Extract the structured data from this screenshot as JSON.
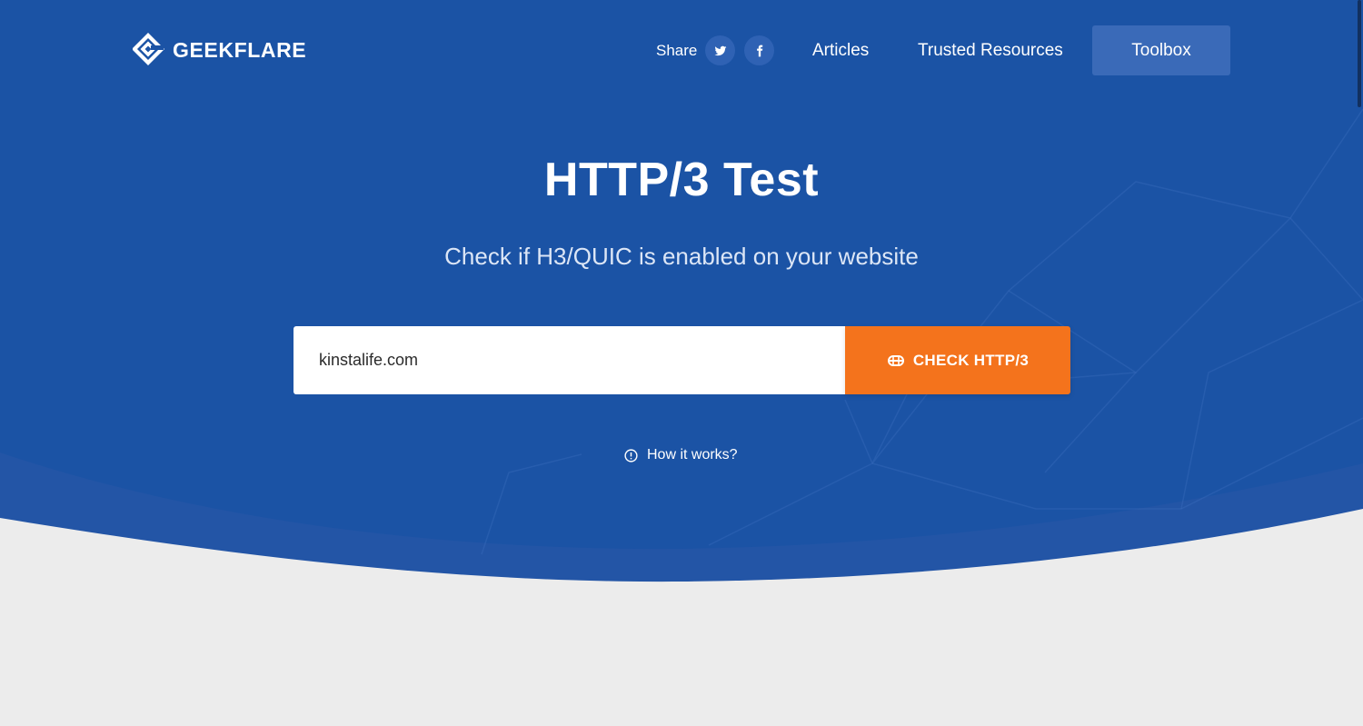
{
  "colors": {
    "hero_blue": "#1b53a5",
    "hero_band": "#2355a6",
    "accent_orange": "#f4731c",
    "page_background": "#ececec"
  },
  "header": {
    "logo_text": "GEEKFLARE",
    "share_label": "Share",
    "social": [
      {
        "icon": "twitter-icon"
      },
      {
        "icon": "facebook-icon"
      }
    ],
    "nav": {
      "articles": "Articles",
      "trusted_resources": "Trusted Resources",
      "toolbox": "Toolbox"
    }
  },
  "hero": {
    "title": "HTTP/3 Test",
    "subtitle": "Check if H3/QUIC is enabled on your website"
  },
  "search": {
    "input_value": "kinstalife.com",
    "button_icon": "rocket-icon",
    "button_label": "CHECK HTTP/3"
  },
  "help": {
    "icon": "info-icon",
    "label": "How it works?"
  }
}
